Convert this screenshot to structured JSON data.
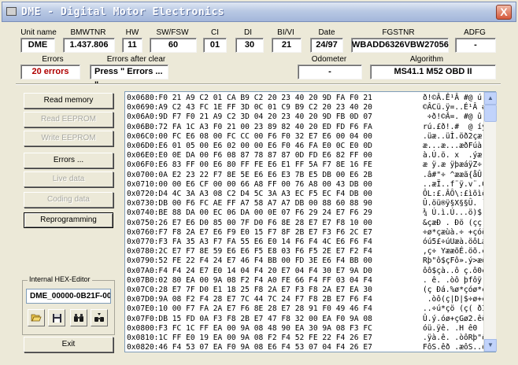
{
  "window": {
    "title": "DME - Digital Motor Electronics",
    "close_glyph": "X"
  },
  "header": {
    "labels": {
      "unit_name": "Unit name",
      "bmwtnr": "BMWTNR",
      "hw": "HW",
      "sw_fsw": "SW/FSW",
      "ci": "CI",
      "di": "DI",
      "bi_vi": "BI/VI",
      "date": "Date",
      "fgstnr": "FGSTNR",
      "adfg": "ADFG",
      "errors": "Errors",
      "errors_after_clear": "Errors after clear",
      "odometer": "Odometer",
      "algorithm": "Algorithm"
    },
    "values": {
      "unit_name": "DME",
      "bmwtnr": "1.437.806",
      "hw": "11",
      "sw_fsw": "60",
      "ci": "01",
      "di": "30",
      "bi_vi": "21",
      "date": "24/97",
      "fgstnr": "WBADD6326VBW27056",
      "adfg": "-",
      "errors": "20 errors",
      "errors_after_clear": "Press \" Errors ... \"",
      "odometer": "-",
      "algorithm": "MS41.1 M52 OBD II"
    }
  },
  "buttons": {
    "read_memory": "Read memory",
    "read_eeprom": "Read EEPROM",
    "write_eeprom": "Write EEPROM",
    "errors": "Errors ...",
    "live_data": "Live data",
    "coding_data": "Coding data",
    "reprogramming": "Reprogramming",
    "exit": "Exit"
  },
  "hex_editor": {
    "label": "Internal HEX-Editor",
    "filename": "DME_00000-0B21F-00",
    "rows": [
      {
        "hex": "0x0680:F0 21 A9 C2 01 CA B9 C2 20 23 40 20 9D FA F0 21",
        "ascii": "ð!©Â.Ê¹Â #@ ú ð!"
      },
      {
        "hex": "0x0690:A9 C2 43 FC 1E FF 3D 0C 01 C9 B9 C2 20 23 40 20",
        "ascii": "©ÂCü.ÿ=..É¹Â #@ "
      },
      {
        "hex": "0x06A0:9D F7 F0 21 A9 C2 3D 04 20 23 40 20 9D FB 0D 07",
        "ascii": " ÷ð!©Â=. #@ û.."
      },
      {
        "hex": "0x06B0:72 FA 1C A3 F0 21 00 23 89 82 40 20 ED FD F6 FA",
        "ascii": "rú.£ð!.#  @ íýöú"
      },
      {
        "hex": "0x06C0:00 FC E6 08 00 FC CC 00 F6 F0 32 E7 E6 00 04 00",
        "ascii": ".üæ..üÌ.öð2çæ..."
      },
      {
        "hex": "0x06D0:E6 01 05 00 E6 02 00 00 E6 F0 46 FA E0 0C E0 0D",
        "ascii": "æ...æ...æðFúà.à."
      },
      {
        "hex": "0x06E0:E0 0E DA 00 F6 08 87 78 87 87 0D FD E6 82 FF 00",
        "ascii": "à.Ú.ö. x  .ýæ ÿ."
      },
      {
        "hex": "0x06F0:E6 83 FF 00 E6 80 FF FE E6 E1 FF 5A F7 8E 16 FE",
        "ascii": "æ ÿ.æ ÿþæáÿZ÷ .þ"
      },
      {
        "hex": "0x0700:0A E2 23 22 F7 8E 5E E6 E6 E3 7B E5 DB 00 E6 2B",
        "ascii": ".â#\"÷ ^ææã{åÛ.æ+"
      },
      {
        "hex": "0x0710:00 00 E6 CF 00 00 66 A8 FF 00 76 A8 00 43 DB 00",
        "ascii": "..æÏ..f¨ÿ.v¨.CÛ."
      },
      {
        "hex": "0x0720:D4 4C 3A A3 08 C2 D4 5C 3A A3 EC F5 EC F4 DB 00",
        "ascii": "ÔL:£.ÂÔ\\:£ìõìôÛ."
      },
      {
        "hex": "0x0730:DB 00 F6 FC AE FF A7 58 A7 A7 DB 00 88 60 88 90",
        "ascii": "Û.öü®ÿ§X§§Û. ` "
      },
      {
        "hex": "0x0740:BE 88 DA 00 EC 06 DA 00 0E 07 F6 29 24 E7 F6 29",
        "ascii": "¾ Ú.ì.Ú...ö)$ çö)"
      },
      {
        "hex": "0x0750:26 E7 E6 D0 85 00 7F D0 F6 8E 28 E7 E7 F8 10 00",
        "ascii": "&çæÐ . Ðö (çç ø.."
      },
      {
        "hex": "0x0760:F7 F8 2A E7 E6 F9 E0 15 F7 8F 2B E7 F3 F6 2C E7",
        "ascii": "÷ø*çæùà.÷ +çóö,ç"
      },
      {
        "hex": "0x0770:F3 FA 35 A3 F7 FA 55 E6 E0 14 F6 F4 4C E6 F6 F4",
        "ascii": "óú5£÷úUæà.öôLæöô"
      },
      {
        "hex": "0x0780:2C E7 F7 8E 59 E6 E6 F5 E8 03 F6 F5 2E E7 F2 F4",
        "ascii": ",ç÷ YææõÉ.öõ.çòô"
      },
      {
        "hex": "0x0790:52 FE 22 F4 24 E7 46 F4 BB 00 FD 3E E6 F4 BB 00",
        "ascii": "Rþ\"ô$çFô».ý>æô»."
      },
      {
        "hex": "0x07A0:F4 F4 24 E7 E0 14 04 F4 20 E7 04 F4 30 E7 9A D0",
        "ascii": "ôô$çà..ô ç.ô0ç Ð"
      },
      {
        "hex": "0x07B0:02 80 EA 00 9A 08 F2 F4 A0 FE 66 F4 FF 03 04 F4",
        "ascii": ". ê. .òô þfôÿ..ô"
      },
      {
        "hex": "0x07C0:28 E7 7F D0 E1 18 25 F8 2A E7 F3 F8 2A E7 EA 30",
        "ascii": "(ç Ðá.%ø*çóø*çê0"
      },
      {
        "hex": "0x07D0:9A 08 F2 F4 28 E7 7C 44 7C 24 F7 F8 2B E7 F6 F4",
        "ascii": " .òô(ç|D|$÷ø+çöô"
      },
      {
        "hex": "0x07E0:10 00 F7 FA 2A E7 F6 8E 28 E7 28 91 F0 49 46 F4",
        "ascii": "..÷ú*çö (ç( ðIFô"
      },
      {
        "hex": "0x07F0:DB 15 FD 0A F3 F8 2B E7 47 F8 32 00 EA F0 9A 08",
        "ascii": "Û.ý.óø+çGø2.êð ."
      },
      {
        "hex": "0x0800:F3 FC 1C FF EA 00 9A 08 48 90 EA 30 9A 08 F3 FC",
        "ascii": "óü.ÿê. .H ê0 .óü"
      },
      {
        "hex": "0x0810:1C FF E0 19 EA 00 9A 08 F2 F4 52 FE 22 F4 26 E7",
        "ascii": ".ÿà.ê. .òôRþ\"ô&ç"
      },
      {
        "hex": "0x0820:46 F4 53 07 EA F0 9A 08 E6 F4 53 07 04 F4 26 E7",
        "ascii": "FôS.êð .æôS..ô&ç"
      }
    ]
  },
  "colors": {
    "window_bg": "#ece9d8",
    "title_gradient_top": "#e0e7f3",
    "title_gradient_bottom": "#a3b6da",
    "close_button": "#d5583b",
    "error_text": "#b00000"
  },
  "icons": {
    "open": "folder-open-icon",
    "save": "floppy-disk-icon",
    "search": "binoculars-icon",
    "search_next": "binoculars-next-icon"
  }
}
